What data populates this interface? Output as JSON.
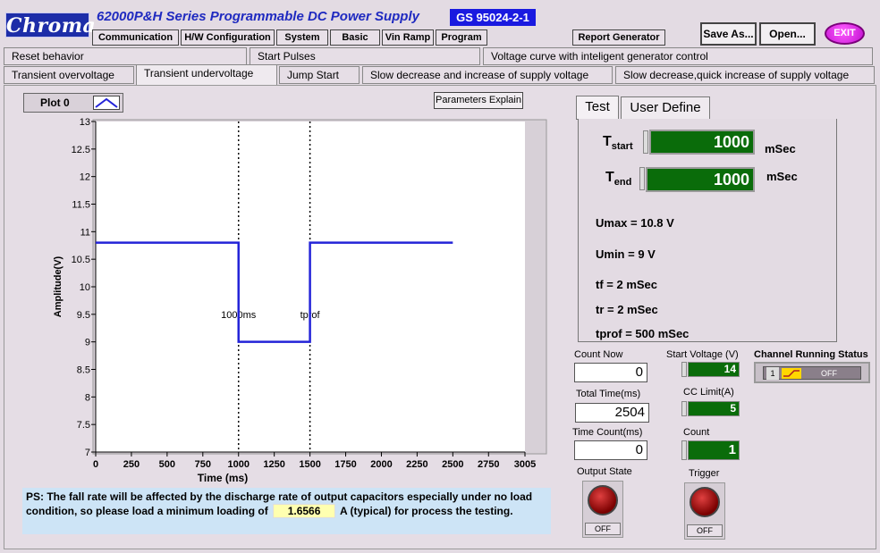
{
  "header": {
    "logo": "Chroma",
    "title": "62000P&H Series  Programmable DC Power Supply",
    "standard": "GS 95024-2-1"
  },
  "menu": [
    "Communication",
    "H/W Configuration",
    "System",
    "Basic",
    "Vin Ramp",
    "Program"
  ],
  "report_button": "Report Generator",
  "save_as_button": "Save As...",
  "open_button": "Open...",
  "exit_button": "EXIT",
  "tabs_row1": [
    "Reset behavior",
    "Start Pulses",
    "Voltage curve with inteligent generator control"
  ],
  "tabs_row2": [
    "Transient overvoltage",
    "Transient undervoltage",
    "Jump Start",
    "Slow decrease and increase of supply voltage",
    "Slow decrease,quick increase of supply voltage"
  ],
  "plot": {
    "legend_label": "Plot 0",
    "parameters_explain": "Parameters Explain"
  },
  "chart_data": {
    "type": "line",
    "xlabel": "Time (ms)",
    "ylabel": "Amplitude(V)",
    "xlim": [
      0,
      3005
    ],
    "ylim": [
      7,
      13
    ],
    "x_ticks": [
      0,
      250,
      500,
      750,
      1000,
      1250,
      1500,
      1750,
      2000,
      2250,
      2500,
      2750,
      3005
    ],
    "y_ticks": [
      7,
      7.5,
      8,
      8.5,
      9,
      9.5,
      10,
      10.5,
      11,
      11.5,
      12,
      12.5,
      13
    ],
    "series": [
      {
        "x": [
          0,
          1000,
          1000,
          1500,
          1500,
          2500
        ],
        "y": [
          10.8,
          10.8,
          9,
          9,
          10.8,
          10.8
        ],
        "color": "#2323d8"
      }
    ],
    "cursors": [
      {
        "x": 1000,
        "label": "1000ms"
      },
      {
        "x": 1500,
        "label": "tprof"
      }
    ],
    "grid": false
  },
  "ps_note": {
    "text_before": "PS: The fall rate will be affected by the discharge rate of output capacitors especially under no load condition, so please load a minimum loading of",
    "value": "1.6566",
    "text_after": "A (typical) for process the testing."
  },
  "right_tabs": [
    "Test",
    "User Define"
  ],
  "test_panel": {
    "tstart_label": "T",
    "tstart_sub": "start",
    "tstart_value": "1000",
    "tend_label": "T",
    "tend_sub": "end",
    "tend_value": "1000",
    "unit": "mSec",
    "umax": "Umax = 10.8 V",
    "umin": "Umin = 9 V",
    "tf": "tf = 2 mSec",
    "tr": "tr = 2 mSec",
    "tprof": "tprof = 500 mSec"
  },
  "counters": {
    "count_now_label": "Count Now",
    "count_now_value": "0",
    "total_time_label": "Total Time(ms)",
    "total_time_value": "2504",
    "time_count_label": "Time Count(ms)",
    "time_count_value": "0",
    "start_voltage_label": "Start Voltage (V)",
    "start_voltage_value": "14",
    "cc_limit_label": "CC Limit(A)",
    "cc_limit_value": "5",
    "count_label": "Count",
    "count_value": "1"
  },
  "channel_status": {
    "label": "Channel Running Status",
    "channel": "1",
    "state": "OFF"
  },
  "output_state": {
    "label": "Output State",
    "state": "OFF"
  },
  "trigger": {
    "label": "Trigger",
    "state": "OFF"
  }
}
